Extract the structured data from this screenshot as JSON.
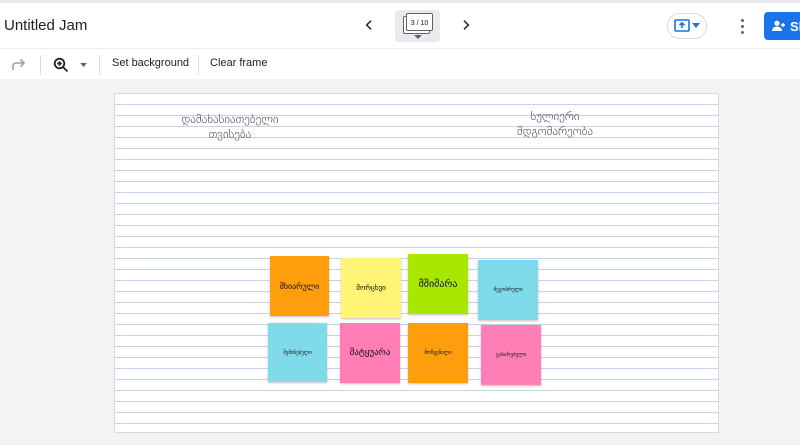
{
  "header": {
    "title": "Untitled Jam",
    "frame_counter": "3 / 10",
    "share_label": "Sh"
  },
  "toolbar": {
    "set_background": "Set background",
    "clear_frame": "Clear frame"
  },
  "canvas": {
    "headings": {
      "left_line1": "დამახასიათებელი",
      "left_line2": "თვისება",
      "right_line1": "სულიერი",
      "right_line2": "მდგომარეობა"
    },
    "notes": [
      {
        "label": "მხიარული",
        "color": "#ff9e0d"
      },
      {
        "label": "მორცხვი",
        "color": "#fff475"
      },
      {
        "label": "მშიშარა",
        "color": "#aae700"
      },
      {
        "label": "მეგობრული",
        "color": "#7fdbea"
      },
      {
        "label": "შემინებული",
        "color": "#7fdbea"
      },
      {
        "label": "მატყუარა",
        "color": "#ff7eb6"
      },
      {
        "label": "მოწყენილი",
        "color": "#ff9e0d"
      },
      {
        "label": "გახარებული",
        "color": "#ff7eb6"
      }
    ]
  },
  "colors": {
    "accent": "#1a73e8",
    "canvas_lines": "#c5d3e8"
  },
  "icons": [
    "chevron-left-icon",
    "chevron-right-icon",
    "present-icon",
    "more-vert-icon",
    "person-add-icon",
    "redo-icon",
    "zoom-icon"
  ]
}
